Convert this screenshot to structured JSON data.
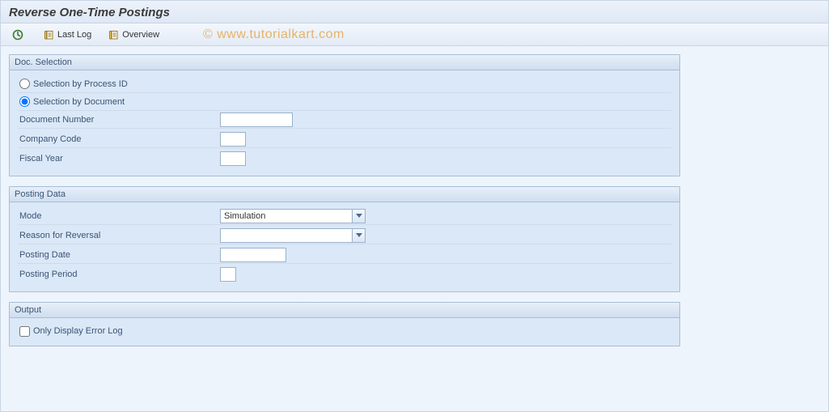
{
  "title": "Reverse One-Time Postings",
  "toolbar": {
    "last_log": "Last Log",
    "overview": "Overview"
  },
  "watermark": "© www.tutorialkart.com",
  "doc_selection": {
    "header": "Doc. Selection",
    "radio_by_process": "Selection by Process ID",
    "radio_by_document": "Selection by Document",
    "selected_radio": "by_document",
    "doc_number": {
      "label": "Document Number",
      "value": ""
    },
    "company_code": {
      "label": "Company Code",
      "value": ""
    },
    "fiscal_year": {
      "label": "Fiscal Year",
      "value": ""
    }
  },
  "posting_data": {
    "header": "Posting Data",
    "mode": {
      "label": "Mode",
      "value": "Simulation"
    },
    "reason": {
      "label": "Reason for Reversal",
      "value": ""
    },
    "posting_date": {
      "label": "Posting Date",
      "value": ""
    },
    "posting_period": {
      "label": "Posting Period",
      "value": ""
    }
  },
  "output": {
    "header": "Output",
    "only_error_log": {
      "label": "Only Display Error Log",
      "checked": false
    }
  }
}
